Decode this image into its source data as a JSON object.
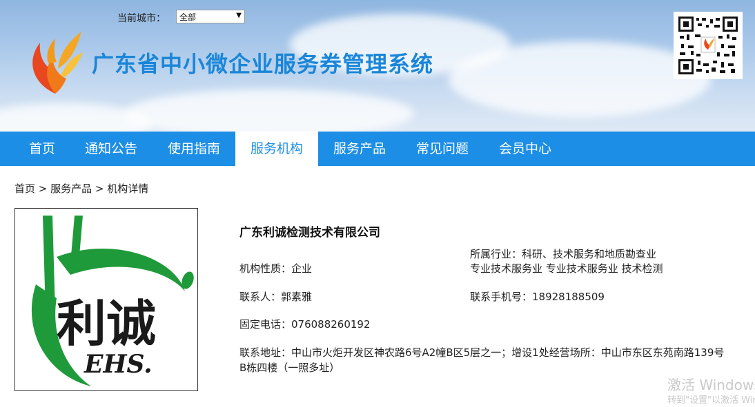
{
  "header": {
    "city_label": "当前城市：",
    "city_selected": "全部",
    "site_title": "广东省中小微企业服务券管理系统"
  },
  "nav": {
    "items": [
      {
        "label": "首页"
      },
      {
        "label": "通知公告"
      },
      {
        "label": "使用指南"
      },
      {
        "label": "服务机构",
        "active": true
      },
      {
        "label": "服务产品"
      },
      {
        "label": "常见问题"
      },
      {
        "label": "会员中心"
      }
    ]
  },
  "breadcrumb": {
    "text": "首页 > 服务产品 > 机构详情"
  },
  "org": {
    "logo_text_cn": "利诚",
    "logo_text_en": "EHS.",
    "name": "广东利诚检测技术有限公司",
    "industry_line1": "所属行业：科研、技术服务和地质勘查业",
    "industry_line2": "专业技术服务业 专业技术服务业 技术检测",
    "nature": "机构性质：企业",
    "contact": "联系人：郭素雅",
    "mobile": "联系手机号：18928188509",
    "phone": "固定电话：076088260192",
    "address": "联系地址：中山市火炬开发区神农路6号A2幢B区5层之一；增设1处经营场所：中山市东区东苑南路139号B栋四楼（一照多址）"
  },
  "watermark": {
    "line1": "激活 Windows",
    "line2": "转到\"设置\"以激活 Windows。"
  }
}
